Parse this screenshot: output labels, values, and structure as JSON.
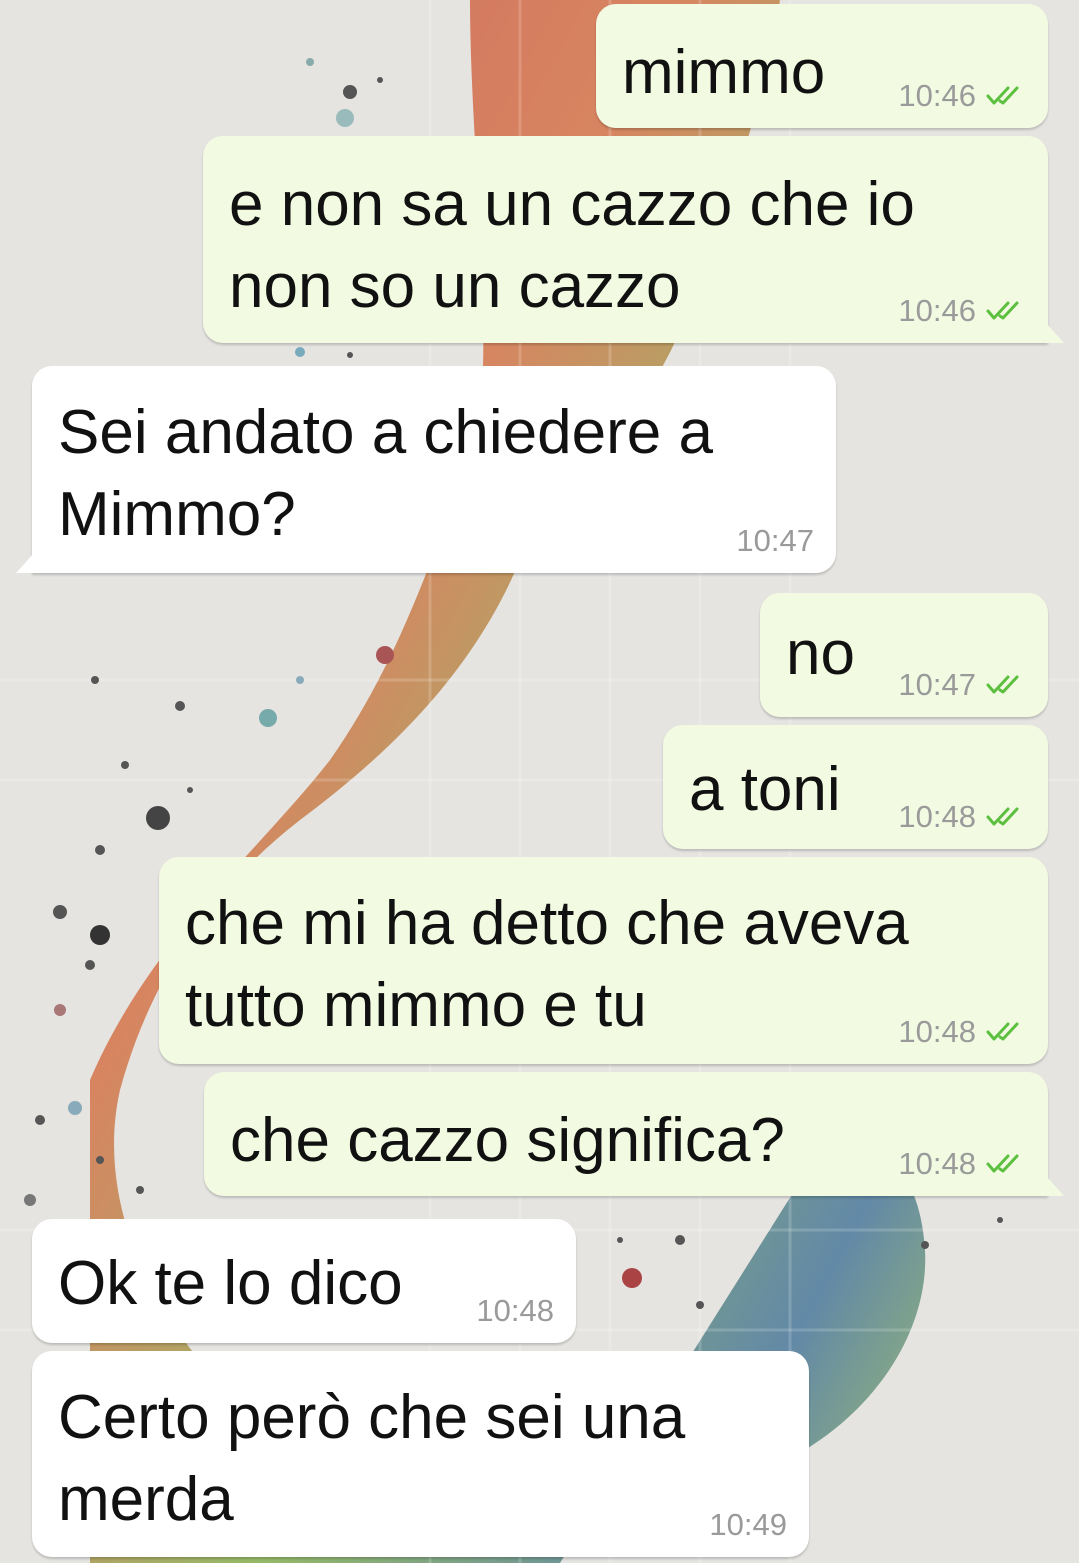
{
  "theme": {
    "outgoing_bubble_color": "#f2fbe2",
    "incoming_bubble_color": "#ffffff",
    "time_color": "#9a9a9a",
    "tick_color": "#5cbf3f",
    "read_status_icon": "double-check-icon"
  },
  "messages": [
    {
      "direction": "outgoing",
      "lines": [
        "mimmo"
      ],
      "time": "10:46",
      "status": "read"
    },
    {
      "direction": "outgoing",
      "lines": [
        "e non sa un cazzo che io",
        "non so un cazzo"
      ],
      "time": "10:46",
      "status": "read"
    },
    {
      "direction": "incoming",
      "lines": [
        "Sei andato a chiedere a",
        "Mimmo?"
      ],
      "time": "10:47"
    },
    {
      "direction": "outgoing",
      "lines": [
        "no"
      ],
      "time": "10:47",
      "status": "read"
    },
    {
      "direction": "outgoing",
      "lines": [
        "a toni"
      ],
      "time": "10:48",
      "status": "read"
    },
    {
      "direction": "outgoing",
      "lines": [
        "che mi ha detto che aveva",
        "tutto mimmo e tu"
      ],
      "time": "10:48",
      "status": "read"
    },
    {
      "direction": "outgoing",
      "lines": [
        "che cazzo significa?"
      ],
      "time": "10:48",
      "status": "read"
    },
    {
      "direction": "incoming",
      "lines": [
        "Ok te lo dico"
      ],
      "time": "10:48"
    },
    {
      "direction": "incoming",
      "lines": [
        "Certo però che sei una",
        "merda"
      ],
      "time": "10:49"
    }
  ]
}
